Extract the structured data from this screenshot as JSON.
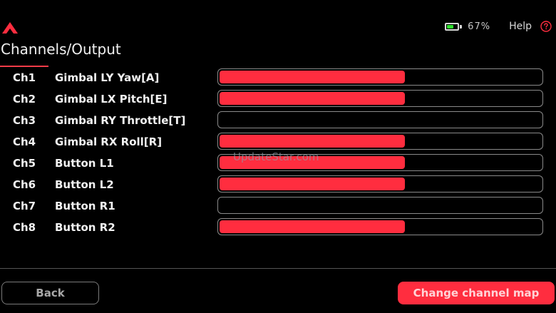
{
  "header": {
    "battery_percent": 67,
    "battery_label": "67%",
    "help_label": "Help",
    "icons": {
      "logo": "brand-logo-icon",
      "battery": "battery-icon",
      "help": "question-circle-icon"
    }
  },
  "page": {
    "title": "Channels/Output"
  },
  "channels": [
    {
      "label": "Ch1",
      "name": "Gimbal LY Yaw[A]",
      "level": 0.58
    },
    {
      "label": "Ch2",
      "name": "Gimbal LX Pitch[E]",
      "level": 0.58
    },
    {
      "label": "Ch3",
      "name": "Gimbal RY Throttle[T]",
      "level": 0
    },
    {
      "label": "Ch4",
      "name": "Gimbal RX Roll[R]",
      "level": 0.58
    },
    {
      "label": "Ch5",
      "name": "Button L1",
      "level": 0.58
    },
    {
      "label": "Ch6",
      "name": "Button L2",
      "level": 0.58
    },
    {
      "label": "Ch7",
      "name": "Button R1",
      "level": 0
    },
    {
      "label": "Ch8",
      "name": "Button R2",
      "level": 0.58
    }
  ],
  "watermark": "UpdateStar.com",
  "footer": {
    "back_label": "Back",
    "change_map_label": "Change channel map"
  },
  "colors": {
    "accent": "#ff2d3f",
    "battery_fill": "#2ee02e",
    "background": "#000000"
  }
}
